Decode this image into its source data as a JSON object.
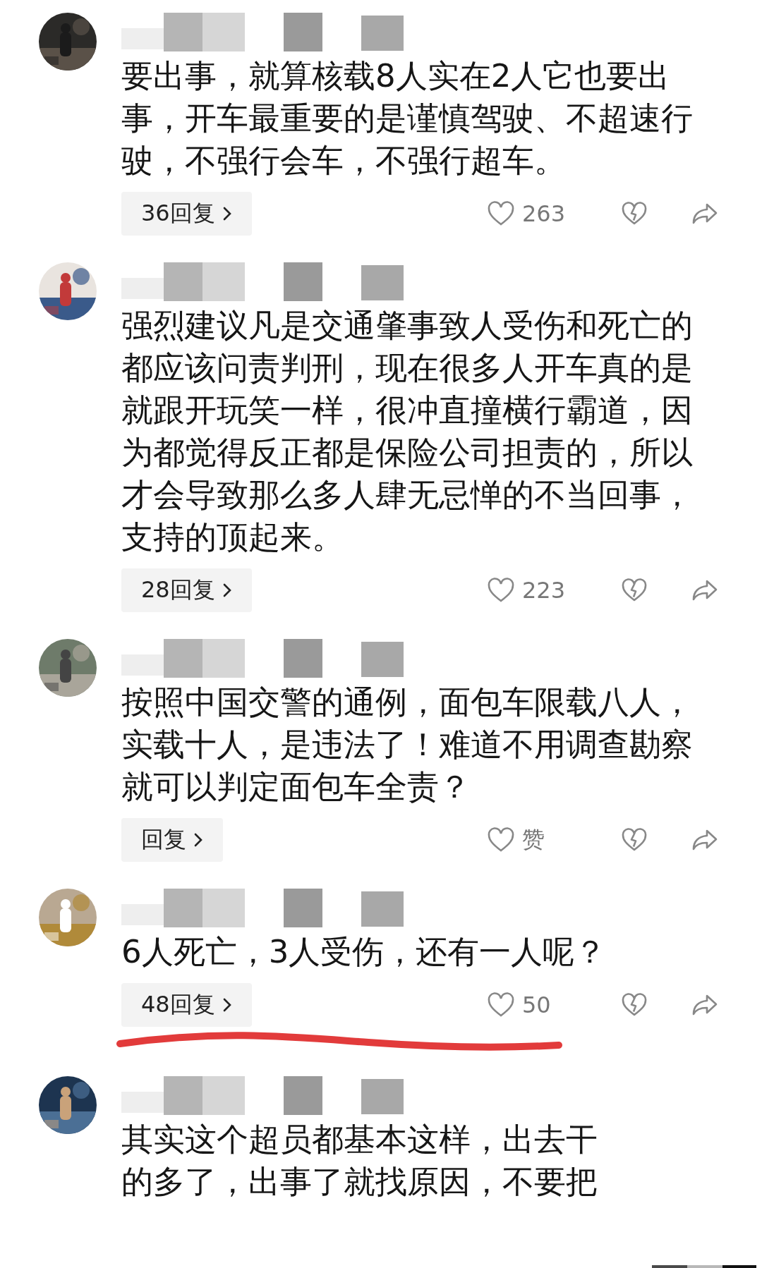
{
  "comments": [
    {
      "text": "要出事，就算核载8人实在2人它也要出事，开车最重要的是谨慎驾驶、不超速行驶，不强行会车，不强行超车。",
      "replies": "36回复",
      "likes": "263"
    },
    {
      "text": "强烈建议凡是交通肇事致人受伤和死亡的都应该问责判刑，现在很多人开车真的是就跟开玩笑一样，很冲直撞横行霸道，因为都觉得反正都是保险公司担责的，所以才会导致那么多人肆无忌惮的不当回事，支持的顶起来。",
      "replies": "28回复",
      "likes": "223"
    },
    {
      "text": "按照中国交警的通例，面包车限载八人，实载十人，是违法了！难道不用调查勘察就可以判定面包车全责？",
      "replies": "回复",
      "likes": "赞"
    },
    {
      "text": "6人死亡，3人受伤，还有一人呢？",
      "replies": "48回复",
      "likes": "50",
      "underlined": true
    },
    {
      "lines": [
        "其实这个超员都基本这样，出去干",
        "的多了，出事了就找原因，不要把"
      ]
    }
  ]
}
